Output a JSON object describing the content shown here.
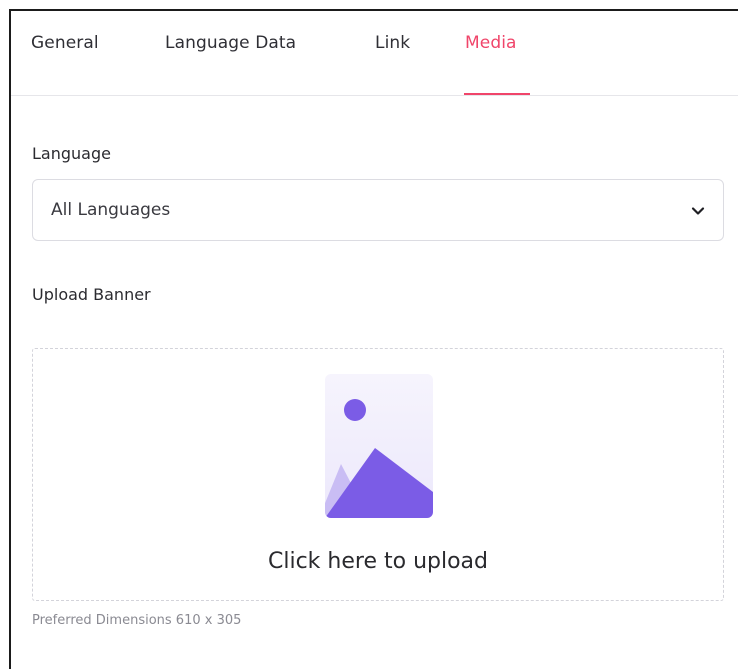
{
  "tabs": [
    {
      "label": "General",
      "active": false
    },
    {
      "label": "Language Data",
      "active": false
    },
    {
      "label": "Link",
      "active": false
    },
    {
      "label": "Media",
      "active": true
    }
  ],
  "colors": {
    "accent": "#f0456a",
    "illustration": "#7b5ce6"
  },
  "language": {
    "label": "Language",
    "selected": "All Languages",
    "icon": "chevron-down-icon"
  },
  "upload": {
    "label": "Upload Banner",
    "cta": "Click here to upload",
    "icon": "image-placeholder-icon",
    "hint": "Preferred Dimensions 610 x 305"
  }
}
